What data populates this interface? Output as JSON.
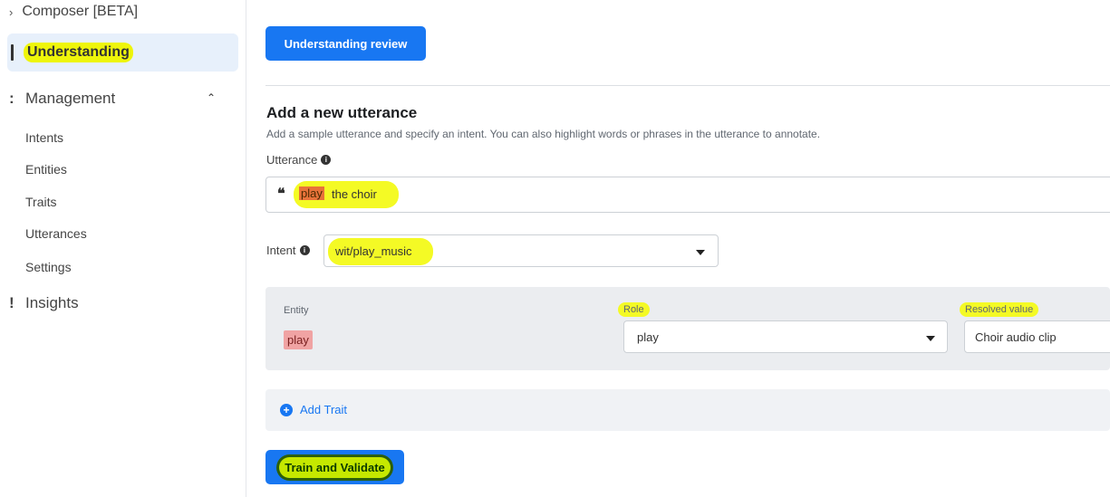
{
  "sidebar": {
    "composer_label": "Composer [BETA]",
    "understanding_label": "Understanding",
    "management_label": "Management",
    "management_items": [
      "Intents",
      "Entities",
      "Traits",
      "Utterances",
      "Settings"
    ],
    "insights_label": "Insights"
  },
  "main": {
    "review_button": "Understanding review",
    "heading": "Add a new utterance",
    "description": "Add a sample utterance and specify an intent. You can also highlight words or phrases in the utterance to annotate.",
    "utterance_label": "Utterance",
    "utterance_token": "play",
    "utterance_rest": "the choir",
    "intent_label": "Intent",
    "intent_value": "wit/play_music",
    "entity_header": "Entity",
    "role_header": "Role",
    "resolved_header": "Resolved value",
    "entity_value": "play",
    "role_value": "play",
    "resolved_value": "Choir audio clip",
    "add_trait_label": "Add Trait",
    "train_button": "Train and Validate"
  },
  "icons": {
    "info": "info-icon",
    "caret": "chevron-down-icon",
    "plus": "plus-circle-icon",
    "quote": "quote-icon"
  },
  "colors": {
    "accent": "#1877f2",
    "highlight": "#f4fa25",
    "entity_chip": "#f0a3a3"
  }
}
